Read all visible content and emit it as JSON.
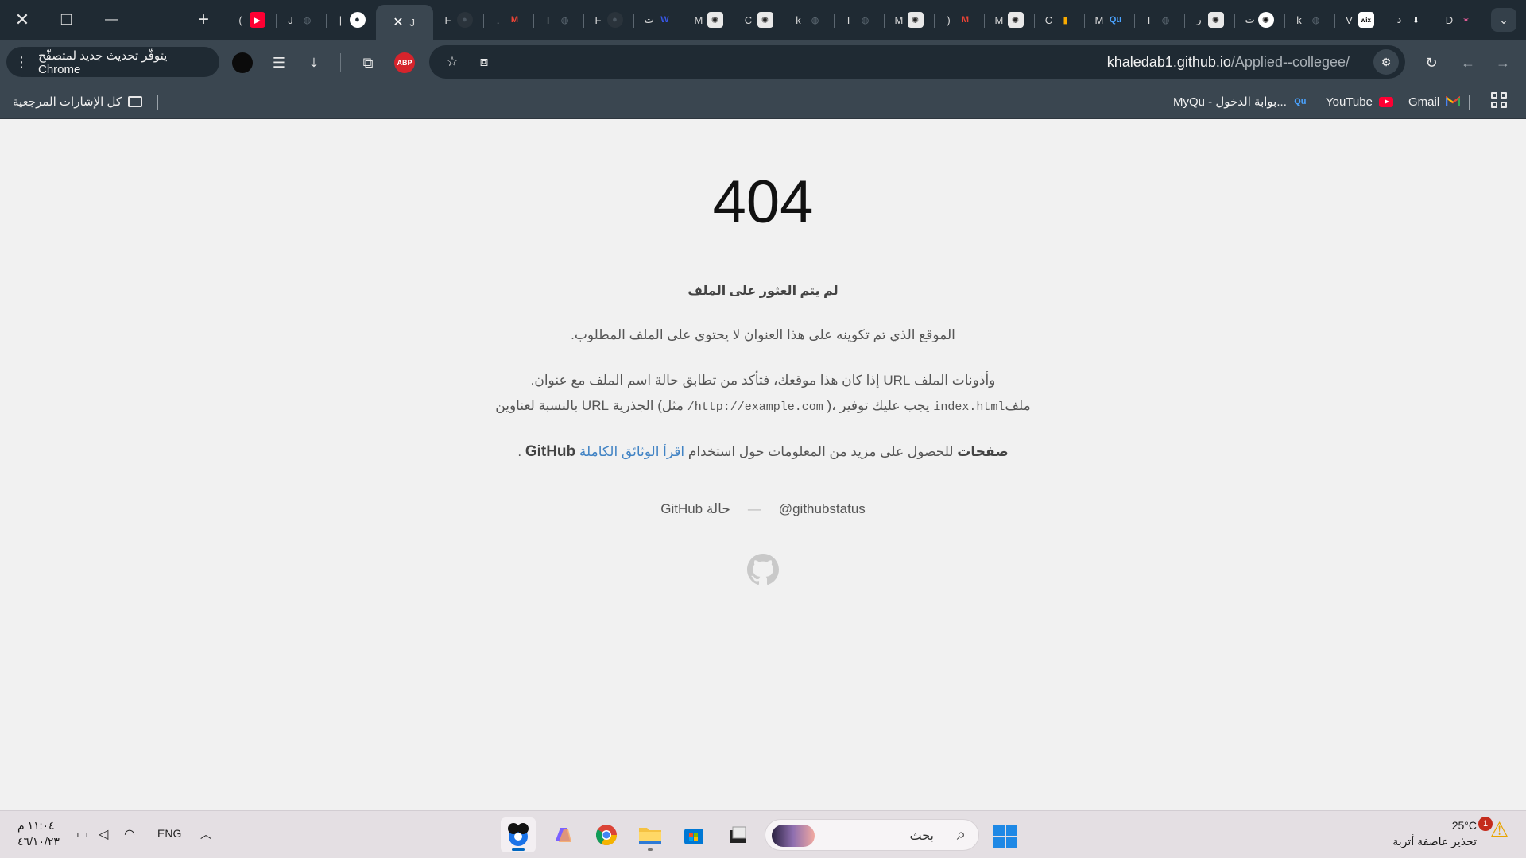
{
  "window": {
    "close": "✕",
    "restore": "❐",
    "minimize": "—",
    "new_tab": "+",
    "tab_search": "⌄"
  },
  "tabs": [
    {
      "letter": "(",
      "icon": "youtube-icon",
      "color": "#ff0033",
      "glyph": "▶"
    },
    {
      "letter": "J",
      "icon": "globe-icon",
      "color": "#5f6b75",
      "glyph": "◍"
    },
    {
      "letter": "|",
      "icon": "github-icon",
      "color": "#ffffff",
      "glyph": "●"
    },
    {
      "letter": "J",
      "icon": "close-icon",
      "active": true
    },
    {
      "letter": "F",
      "icon": "github-icon",
      "color": "#2a333b",
      "glyph": "●"
    },
    {
      "letter": ".",
      "icon": "gmail-icon",
      "color": "#ea4335",
      "glyph": "M"
    },
    {
      "letter": "I",
      "icon": "globe-icon",
      "color": "#5f6b75",
      "glyph": "◍"
    },
    {
      "letter": "F",
      "icon": "github-icon",
      "color": "#2a333b",
      "glyph": "●"
    },
    {
      "letter": "ت",
      "icon": "wordpress-icon",
      "color": "#3858e9",
      "glyph": "W"
    },
    {
      "letter": "M",
      "icon": "openai-icon",
      "color": "#dddddd",
      "glyph": "✺"
    },
    {
      "letter": "C",
      "icon": "openai-icon",
      "color": "#dddddd",
      "glyph": "✺"
    },
    {
      "letter": "k",
      "icon": "globe-icon",
      "color": "#5f6b75",
      "glyph": "◍"
    },
    {
      "letter": "I",
      "icon": "globe-icon",
      "color": "#5f6b75",
      "glyph": "◍"
    },
    {
      "letter": "M",
      "icon": "openai-icon",
      "color": "#dddddd",
      "glyph": "✺"
    },
    {
      "letter": ")",
      "icon": "gmail-icon",
      "color": "#ea4335",
      "glyph": "M"
    },
    {
      "letter": "M",
      "icon": "openai-icon",
      "color": "#dddddd",
      "glyph": "✺"
    },
    {
      "letter": "C",
      "icon": "analytics-icon",
      "color": "#f9ab00",
      "glyph": "▮"
    },
    {
      "letter": "M",
      "icon": "qu-icon",
      "color": "#4aa3ff",
      "glyph": "Qu"
    },
    {
      "letter": "I",
      "icon": "globe-icon",
      "color": "#5f6b75",
      "glyph": "◍"
    },
    {
      "letter": "ر",
      "icon": "openai-icon",
      "color": "#dddddd",
      "glyph": "✺"
    },
    {
      "letter": "ت",
      "icon": "chatgpt-icon",
      "color": "#111111",
      "glyph": "✺"
    },
    {
      "letter": "k",
      "icon": "globe-icon",
      "color": "#5f6b75",
      "glyph": "◍"
    },
    {
      "letter": "V",
      "icon": "wix-icon",
      "color": "#ffffff",
      "glyph": "wix"
    },
    {
      "letter": "د",
      "icon": "download-icon",
      "color": "#ffffff",
      "glyph": "⬇"
    },
    {
      "letter": "D",
      "icon": "colorful-icon",
      "color": "#e85d9a",
      "glyph": "✶"
    }
  ],
  "toolbar": {
    "update_label": "يتوفّر تحديث جديد لمتصفّح Chrome",
    "url_host": "khaledab1.github.io",
    "url_path": "/Applied--collegee/"
  },
  "bookmarks": {
    "all_bookmarks": "كل الإشارات المرجعية",
    "gmail": "Gmail",
    "youtube": "YouTube",
    "myqu": "MyQu - بوابة الدخول..."
  },
  "page": {
    "code": "404",
    "title": "لم يتم العثور على الملف",
    "line1": "الموقع الذي تم تكوينه على هذا العنوان لا يحتوي على الملف المطلوب.",
    "line2": "وأذونات الملف URL إذا كان هذا موقعك، فتأكد من تطابق حالة اسم الملف مع عنوان.",
    "line3_pre": "ملف",
    "line3_code1": "index.html",
    "line3_mid": "يجب عليك توفير ،(",
    "line3_code2": "http://example.com/",
    "line3_post": "مثل) الجذرية URL بالنسبة لعناوين",
    "line4_bold1": "صفحات",
    "line4_text": "للحصول على مزيد من المعلومات حول استخدام",
    "line4_link": "اقرأ الوثائق الكاملة",
    "line4_bold2": "GitHub",
    "line4_dot": ".",
    "footer_status": "GitHub حالة",
    "footer_dash": "—",
    "footer_handle": "@githubstatus"
  },
  "taskbar": {
    "time": "١١:٠٤ م",
    "date": "٤٦/١٠/٢٣",
    "lang": "ENG",
    "search_placeholder": "بحث",
    "weather_temp": "25°C",
    "weather_text": "تحذير عاصفة أتربة",
    "notification_count": "1"
  }
}
